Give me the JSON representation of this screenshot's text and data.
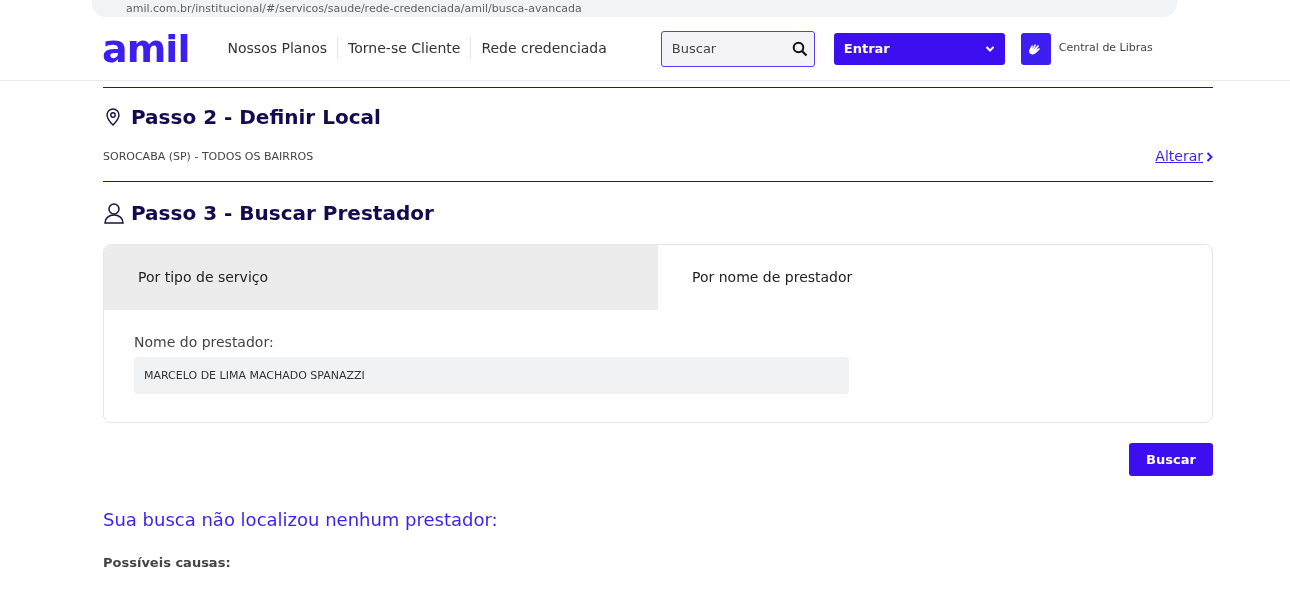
{
  "browser": {
    "url": "amil.com.br/institucional/#/servicos/saude/rede-credenciada/amil/busca-avancada"
  },
  "header": {
    "logo": "amil",
    "nav": [
      "Nossos Planos",
      "Torne-se Cliente",
      "Rede credenciada"
    ],
    "search": {
      "placeholder": "Buscar"
    },
    "login_button": "Entrar",
    "libras": "Central de Libras"
  },
  "step2": {
    "title": "Passo 2 - Definir Local",
    "location": "SOROCABA (SP) - TODOS OS BAIRROS",
    "change_link": "Alterar"
  },
  "step3": {
    "title": "Passo 3 - Buscar Prestador",
    "tabs": [
      {
        "label": "Por tipo de serviço",
        "selected": false
      },
      {
        "label": "Por nome de prestador",
        "selected": true
      }
    ],
    "field_label": "Nome do prestador:",
    "field_value": "MARCELO DE LIMA MACHADO SPANAZZI",
    "search_button": "Buscar"
  },
  "result": {
    "title": "Sua busca não localizou nenhum prestador:",
    "causes_label": "Possíveis causas:"
  }
}
